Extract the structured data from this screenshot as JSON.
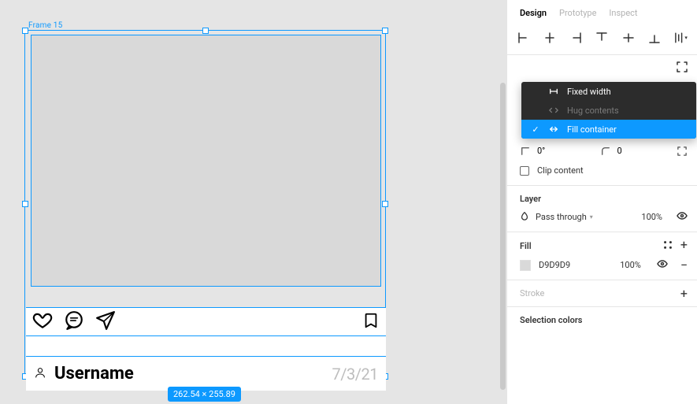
{
  "canvas": {
    "frame_label": "Frame 15",
    "dimensions_badge": "262.54 × 255.89",
    "card": {
      "username": "Username",
      "date": "7/3/21"
    }
  },
  "panel": {
    "tabs": {
      "design": "Design",
      "prototype": "Prototype",
      "inspect": "Inspect"
    },
    "resize_menu": {
      "fixed": "Fixed width",
      "hug": "Hug contents",
      "fill": "Fill container"
    },
    "rotation": "0°",
    "corner_radius": "0",
    "clip_content": "Clip content",
    "layer": {
      "title": "Layer",
      "mode": "Pass through",
      "opacity": "100%"
    },
    "fill": {
      "title": "Fill",
      "hex": "D9D9D9",
      "opacity": "100%"
    },
    "stroke": {
      "title": "Stroke"
    },
    "selection_colors": {
      "title": "Selection colors"
    }
  }
}
